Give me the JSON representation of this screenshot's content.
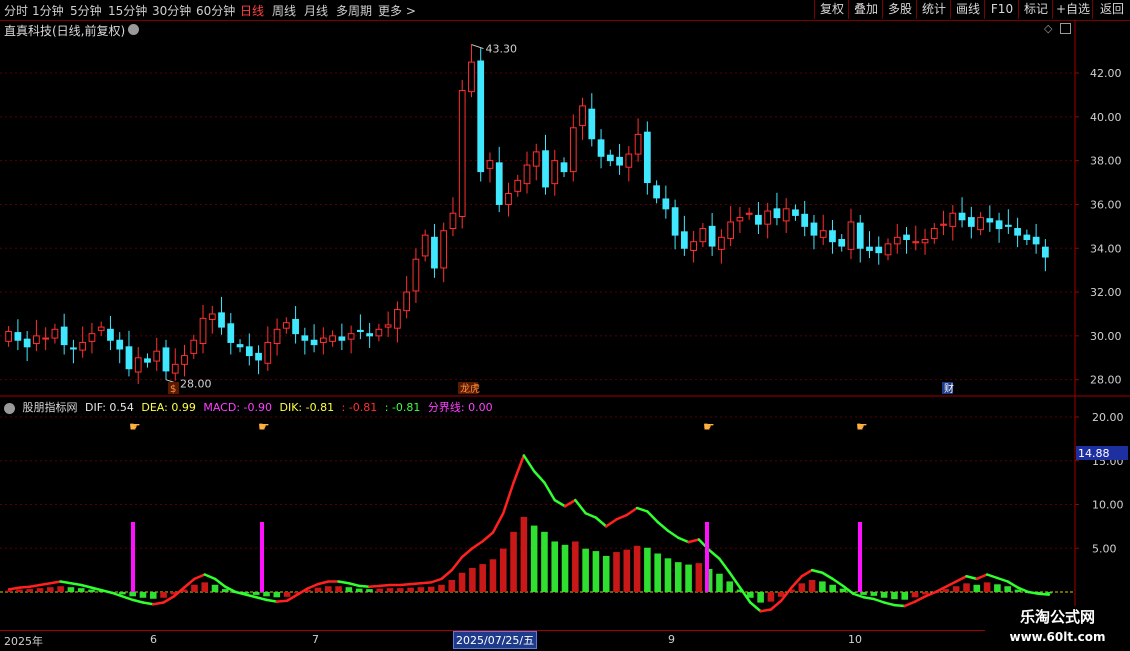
{
  "toolbar": {
    "periods": [
      "分时",
      "1分钟",
      "5分钟",
      "15分钟",
      "30分钟",
      "60分钟",
      "日线",
      "周线",
      "月线",
      "多周期",
      "更多"
    ],
    "active_period": "日线",
    "more_glyph": ">",
    "right_buttons": [
      "复权",
      "叠加",
      "多股",
      "统计",
      "画线",
      "F10",
      "标记",
      "+自选",
      "返回"
    ]
  },
  "stock": {
    "title": "直真科技(日线,前复权)"
  },
  "price_panel": {
    "y_ticks": [
      "28.00",
      "30.00",
      "32.00",
      "34.00",
      "36.00",
      "38.00",
      "40.00",
      "42.00"
    ],
    "high_label": "43.30",
    "low_label": "28.00",
    "event_markers": [
      "$",
      "龙虎",
      "财"
    ]
  },
  "indicator": {
    "name": "股朋指标网",
    "dif": "DIF: 0.54",
    "dea": "DEA: 0.99",
    "macd": "MACD: -0.90",
    "dik": "DIK: -0.81",
    "v1": ": -0.81",
    "v2": ": -0.81",
    "boundary": "分界线: 0.00",
    "y_ticks": [
      "5.00",
      "10.00",
      "15.00",
      "20.00"
    ],
    "current_value": "14.88",
    "colors": {
      "up": "#ff3030",
      "down": "#40ff40",
      "signal": "#ff00ff",
      "dea": "#ffff40",
      "dif": "#ffffff"
    }
  },
  "x_axis": {
    "labels": [
      "2025年",
      "6",
      "7",
      "2025/07/25/五",
      "9",
      "10"
    ]
  },
  "watermark": {
    "title": "乐淘公式网",
    "url": "www.60lt.com"
  },
  "chart_data": {
    "type": "candlestick",
    "price_range": [
      27.3,
      43.6
    ],
    "high": 43.3,
    "low": 28.0,
    "closes": [
      30.2,
      29.8,
      29.5,
      30.0,
      29.9,
      30.3,
      29.6,
      29.4,
      29.7,
      30.1,
      30.4,
      29.8,
      29.4,
      28.5,
      29.0,
      28.8,
      29.3,
      28.4,
      28.7,
      29.1,
      29.8,
      30.8,
      31.0,
      30.4,
      29.7,
      29.5,
      29.1,
      28.9,
      29.7,
      30.3,
      30.6,
      30.1,
      29.8,
      29.6,
      29.9,
      30.0,
      29.8,
      30.1,
      30.2,
      30.0,
      30.3,
      30.5,
      31.2,
      32.0,
      33.5,
      34.6,
      33.1,
      34.8,
      35.6,
      41.2,
      42.5,
      37.5,
      38.0,
      36.0,
      36.5,
      37.1,
      37.8,
      38.4,
      36.8,
      38.0,
      37.5,
      39.5,
      40.5,
      39.0,
      38.2,
      38.0,
      37.8,
      38.3,
      39.2,
      37.0,
      36.3,
      35.8,
      34.6,
      34.0,
      34.3,
      34.9,
      34.1,
      34.5,
      35.2,
      35.4,
      35.6,
      35.1,
      35.7,
      35.4,
      35.8,
      35.5,
      35.0,
      34.6,
      34.8,
      34.3,
      34.1,
      35.2,
      34.0,
      33.9,
      33.8,
      34.2,
      34.5,
      34.4,
      34.3,
      34.4,
      34.9,
      35.1,
      35.6,
      35.3,
      35.0,
      35.4,
      35.2,
      34.9,
      35.0,
      34.6,
      34.4,
      34.2,
      33.6
    ],
    "indicator_line": [
      0.3,
      0.5,
      0.6,
      0.8,
      1.0,
      1.2,
      1.0,
      0.8,
      0.5,
      0.2,
      -0.1,
      -0.5,
      -0.9,
      -1.2,
      -1.4,
      -1.2,
      -0.5,
      0.5,
      1.5,
      2.0,
      1.5,
      0.6,
      0,
      -0.3,
      -0.6,
      -0.9,
      -1.1,
      -1.0,
      -0.3,
      0.4,
      0.9,
      1.2,
      1.2,
      1.0,
      0.7,
      0.6,
      0.7,
      0.8,
      0.8,
      0.9,
      1.0,
      1.1,
      1.5,
      2.5,
      4.0,
      5.0,
      5.8,
      6.8,
      9.0,
      12.5,
      15.6,
      13.8,
      12.5,
      10.5,
      9.8,
      10.5,
      9.0,
      8.5,
      7.5,
      8.3,
      8.8,
      9.6,
      9.2,
      8.0,
      7.0,
      6.2,
      5.7,
      6.0,
      4.8,
      3.8,
      2.2,
      0.5,
      -1.2,
      -2.2,
      -2.0,
      -1.0,
      0.5,
      1.8,
      2.5,
      2.2,
      1.5,
      0.7,
      -0.2,
      -0.6,
      -0.8,
      -1.2,
      -1.5,
      -1.6,
      -1.1,
      -0.5,
      0,
      0.6,
      1.2,
      1.8,
      1.5,
      2.0,
      1.6,
      1.2,
      0.5,
      0,
      -0.2,
      -0.3
    ],
    "signals": [
      "2025-06-04",
      "2025-06-25",
      "2025-09-03",
      "2025-09-29"
    ]
  }
}
